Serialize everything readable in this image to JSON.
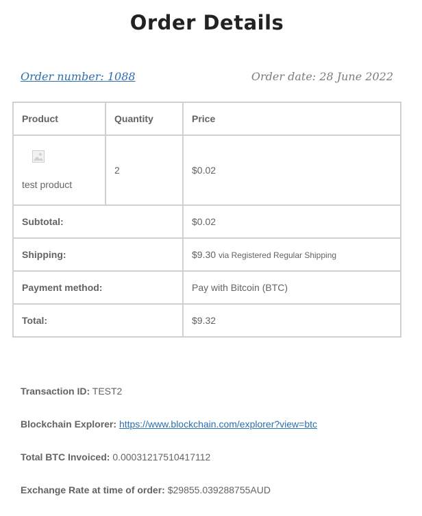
{
  "header": {
    "title": "Order Details"
  },
  "order": {
    "number_label": "Order number: 1088",
    "date_label": "Order date: 28 June 2022"
  },
  "table": {
    "headers": [
      "Product",
      "Quantity",
      "Price"
    ],
    "item": {
      "name": "test product",
      "quantity": "2",
      "price": "$0.02"
    },
    "totals": [
      {
        "label": "Subtotal:",
        "value": "$0.02"
      },
      {
        "label": "Shipping:",
        "value": "$9.30",
        "note": "via Registered Regular Shipping"
      },
      {
        "label": "Payment method:",
        "value": "Pay with Bitcoin (BTC)"
      },
      {
        "label": "Total:",
        "value": "$9.32"
      }
    ]
  },
  "crypto": {
    "transaction_label": "Transaction ID:",
    "transaction_value": "TEST2",
    "explorer_label": "Blockchain Explorer:",
    "explorer_link": "https://www.blockchain.com/explorer?view=btc",
    "btc_label": "Total BTC Invoiced:",
    "btc_value": "0.00031217510417112",
    "rate_label": "Exchange Rate at time of order:",
    "rate_value": "$29855.039288755AUD"
  },
  "icons": {
    "product_image": "image-placeholder-icon"
  }
}
